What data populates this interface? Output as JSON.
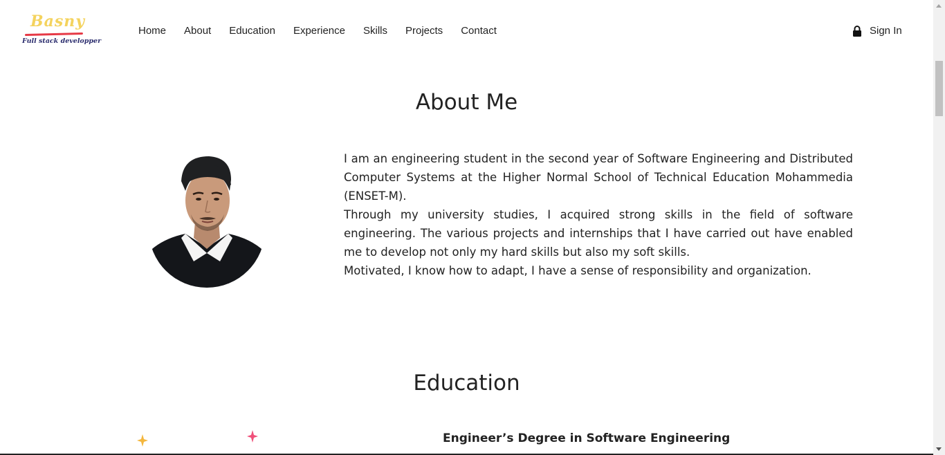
{
  "logo": {
    "name": "Basny",
    "tagline": "Full stack developper",
    "name_color": "#f4d35e",
    "underline_color": "#e63946",
    "tagline_color": "#2b2d6e"
  },
  "nav": {
    "items": [
      {
        "label": "Home"
      },
      {
        "label": "About"
      },
      {
        "label": "Education"
      },
      {
        "label": "Experience"
      },
      {
        "label": "Skills"
      },
      {
        "label": "Projects"
      },
      {
        "label": "Contact"
      }
    ],
    "signin": {
      "label": "Sign In",
      "icon": "lock-icon"
    }
  },
  "about": {
    "title": "About Me",
    "avatar_icon": "profile-photo",
    "paragraphs": [
      "I am an engineering student in the second year of Software Engineering and Distributed Computer Systems at the Higher Normal School of Technical Education Mohammedia (ENSET-M).",
      "Through my university studies, I acquired strong skills in the field of software engineering. The various projects and internships that I have carried out have enabled me to develop not only my hard skills but also my soft skills.",
      "Motivated, I know how to adapt, I have a sense of responsibility and organization."
    ]
  },
  "education": {
    "title": "Education",
    "degree": "Engineer’s Degree in Software Engineering",
    "sparkle_colors": [
      "#f4b73e",
      "#f0507a"
    ]
  }
}
